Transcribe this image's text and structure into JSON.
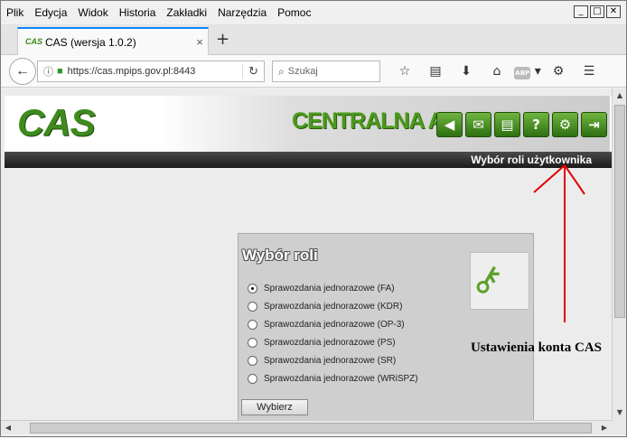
{
  "menu": [
    "Plik",
    "Edycja",
    "Widok",
    "Historia",
    "Zakładki",
    "Narzędzia",
    "Pomoc"
  ],
  "window_buttons": {
    "minimize": "_",
    "maximize": "□",
    "close": "✕"
  },
  "tab": {
    "favicon_text": "CAS",
    "title": "CAS (wersja 1.0.2)",
    "close": "×",
    "new_tab": "+"
  },
  "nav": {
    "back": "←",
    "info_icon": "ⓘ",
    "lock_icon": "🔒",
    "url": "https://cas.mpips.gov.pl:8443",
    "reload": "↻",
    "search_placeholder": "Szukaj",
    "icons": {
      "bookmark": "☆",
      "reader": "▤",
      "download": "⬇",
      "home": "⌂",
      "abp": "ABP",
      "addon": "⚙",
      "menu": "☰"
    }
  },
  "page": {
    "logo": "CAS",
    "app_title": "CENTRALNA AP",
    "toolbar": {
      "back": "◀",
      "mail": "✉",
      "doc": "▤",
      "help": "?",
      "settings": "⚙",
      "exit": "⇥"
    },
    "darkbar_text": "Wybór roli użytkownika"
  },
  "role_panel": {
    "title": "Wybór roli",
    "options": [
      {
        "label": "Sprawozdania jednorazowe (FA)",
        "selected": true
      },
      {
        "label": "Sprawozdania jednorazowe (KDR)",
        "selected": false
      },
      {
        "label": "Sprawozdania jednorazowe (OP-3)",
        "selected": false
      },
      {
        "label": "Sprawozdania jednorazowe (PS)",
        "selected": false
      },
      {
        "label": "Sprawozdania jednorazowe (SR)",
        "selected": false
      },
      {
        "label": "Sprawozdania jednorazowe (WRiSPZ)",
        "selected": false
      }
    ],
    "button": "Wybierz"
  },
  "annotation": "Ustawienia konta CAS",
  "colors": {
    "accent_green": "#3e8a1e",
    "annotation_red": "#e00000",
    "tab_accent": "#0a84ff"
  }
}
